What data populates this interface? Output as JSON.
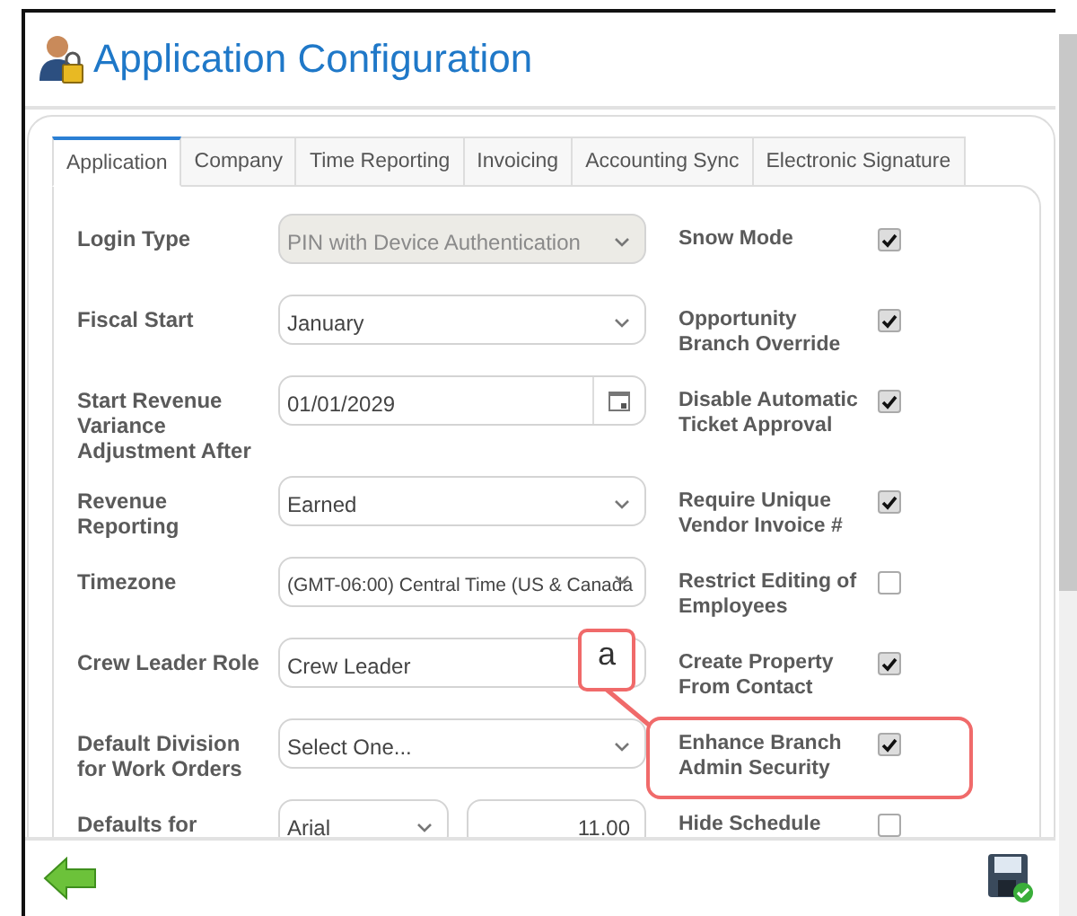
{
  "window": {
    "title": "Application Configuration"
  },
  "tabs": [
    {
      "label": "Application",
      "selected": true
    },
    {
      "label": "Company",
      "selected": false
    },
    {
      "label": "Time Reporting",
      "selected": false
    },
    {
      "label": "Invoicing",
      "selected": false
    },
    {
      "label": "Accounting Sync",
      "selected": false
    },
    {
      "label": "Electronic Signature",
      "selected": false
    }
  ],
  "rows": [
    {
      "label": "Login Type",
      "field": {
        "kind": "select",
        "value": "PIN with Device Authentication",
        "disabled": true
      },
      "option": {
        "label": "Snow Mode",
        "checked": true,
        "highlighted": false
      }
    },
    {
      "label": "Fiscal Start",
      "field": {
        "kind": "select",
        "value": "January",
        "disabled": false
      },
      "option": {
        "label": "Opportunity Branch Override",
        "checked": true,
        "highlighted": false
      }
    },
    {
      "label": "Start Revenue Variance Adjustment After",
      "field": {
        "kind": "date",
        "value": "01/01/2029",
        "disabled": false
      },
      "option": {
        "label": "Disable Automatic Ticket Approval",
        "checked": true,
        "highlighted": false
      }
    },
    {
      "label": "Revenue Reporting",
      "field": {
        "kind": "select",
        "value": "Earned",
        "disabled": false
      },
      "option": {
        "label": "Require Unique Vendor Invoice #",
        "checked": true,
        "highlighted": false
      }
    },
    {
      "label": "Timezone",
      "field": {
        "kind": "select",
        "value": "(GMT-06:00) Central Time (US & Canada",
        "disabled": false
      },
      "option": {
        "label": "Restrict Editing of Employees",
        "checked": false,
        "highlighted": false
      }
    },
    {
      "label": "Crew Leader Role",
      "field": {
        "kind": "text",
        "value": "Crew Leader",
        "disabled": false
      },
      "option": {
        "label": "Create Property From Contact",
        "checked": true,
        "highlighted": false
      }
    },
    {
      "label": "Default Division for Work Orders",
      "field": {
        "kind": "select",
        "value": "Select One...",
        "disabled": false
      },
      "option": {
        "label": "Enhance Branch Admin Security",
        "checked": true,
        "highlighted": true
      },
      "callout": "a"
    },
    {
      "label": "Defaults for",
      "field": {
        "kind": "font",
        "value": "Arial",
        "size": "11.00",
        "disabled": false
      },
      "option": {
        "label": "Hide Schedule",
        "checked": false,
        "highlighted": false
      }
    }
  ]
}
